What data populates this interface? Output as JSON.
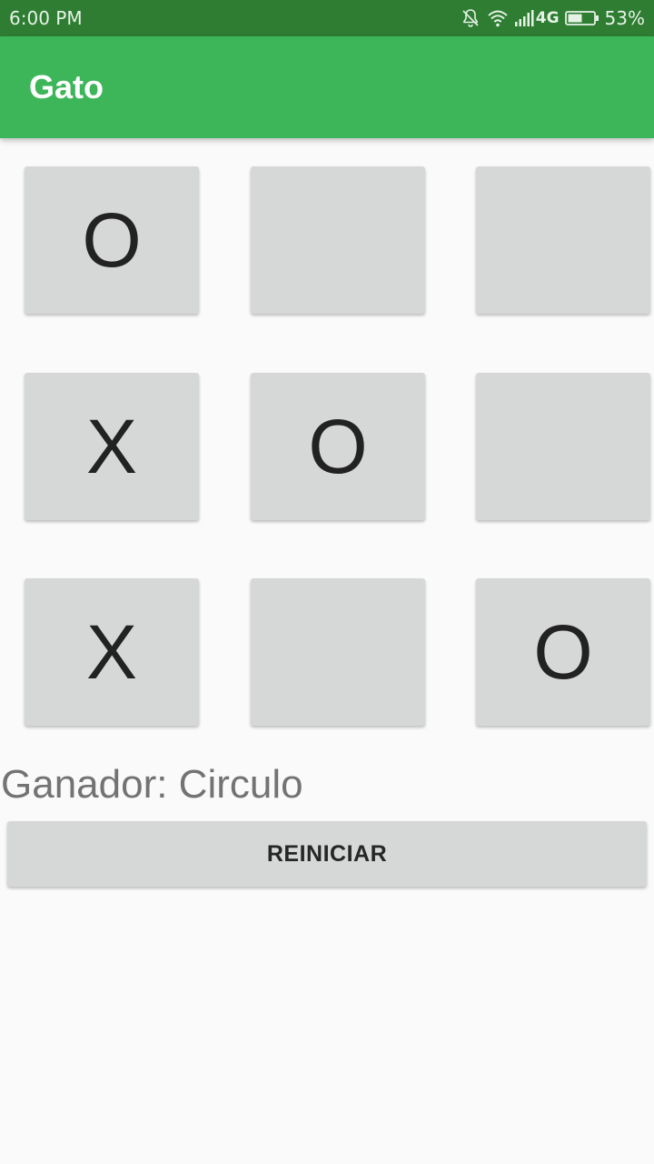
{
  "status_bar": {
    "time": "6:00 PM",
    "network": "4G",
    "battery": "53%",
    "icons": [
      "bell-off-icon",
      "wifi-icon",
      "signal-icon",
      "battery-icon"
    ]
  },
  "app_bar": {
    "title": "Gato",
    "color": "#3db65a"
  },
  "board": {
    "cells": [
      "O",
      "",
      "",
      "X",
      "O",
      "",
      "X",
      "",
      "O"
    ]
  },
  "winner_text": "Ganador: Circulo",
  "reset_label": "REINICIAR"
}
